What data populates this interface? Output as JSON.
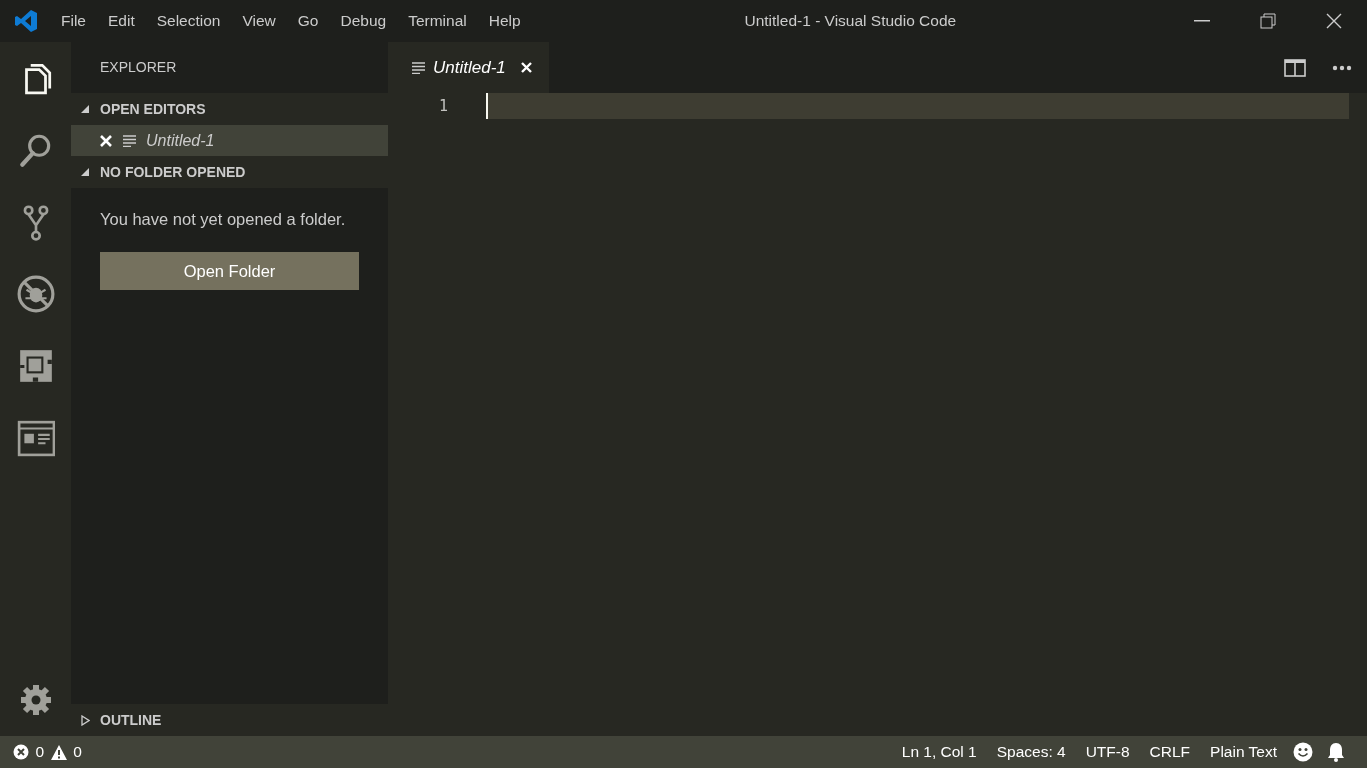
{
  "window": {
    "title": "Untitled-1 - Visual Studio Code"
  },
  "menu": [
    "File",
    "Edit",
    "Selection",
    "View",
    "Go",
    "Debug",
    "Terminal",
    "Help"
  ],
  "activity_bar": [
    {
      "kind": "explorer",
      "selected": true
    },
    {
      "kind": "search",
      "selected": false
    },
    {
      "kind": "source-control",
      "selected": false
    },
    {
      "kind": "debug",
      "selected": false
    },
    {
      "kind": "extensions",
      "selected": false
    },
    {
      "kind": "preview",
      "selected": false
    }
  ],
  "sidebar": {
    "title": "EXPLORER",
    "sections": [
      {
        "title": "OPEN EDITORS",
        "expanded": true,
        "items": [
          {
            "label": "Untitled-1",
            "selected": true
          }
        ]
      },
      {
        "title": "NO FOLDER OPENED",
        "expanded": true,
        "message": "You have not yet opened a folder.",
        "button": "Open Folder"
      },
      {
        "title": "OUTLINE",
        "expanded": false
      }
    ]
  },
  "tabs": [
    {
      "label": "Untitled-1",
      "selected": true
    }
  ],
  "editor": {
    "line_numbers": [
      "1"
    ]
  },
  "status_bar": {
    "errors": "0",
    "warnings": "0",
    "right": [
      "Ln 1, Col 1",
      "Spaces: 4",
      "UTF-8",
      "CRLF",
      "Plain Text"
    ]
  }
}
